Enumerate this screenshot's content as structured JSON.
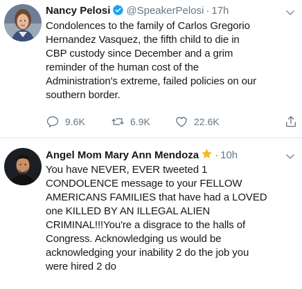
{
  "tweets": [
    {
      "name": "Nancy Pelosi",
      "handle": "@SpeakerPelosi",
      "separator": "·",
      "time": "17h",
      "text": "Condolences to the family of Carlos Gregorio\nHernandez Vasquez, the fifth child to die in\nCBP custody since December and a grim\nreminder of the human cost of the\nAdministration's extreme, failed policies on our\nsouthern border.",
      "replies": "9.6K",
      "retweets": "6.9K",
      "likes": "22.6K",
      "verified": true
    },
    {
      "name": "Angel Mom Mary Ann Mendoza",
      "separator": "·",
      "time": "10h",
      "text": "You have NEVER, EVER tweeted 1\nCONDOLENCE message to your FELLOW\nAMERICANS FAMILIES that have had a LOVED\none KILLED BY AN ILLEGAL ALIEN\nCRIMINAL!!!You're a disgrace to the halls of\nCongress.  Acknowledging us would be\nacknowledging your inability 2 do the job you\nwere hired 2 do"
    }
  ],
  "icons": {
    "verified": "verified-badge-icon",
    "star": "star-icon",
    "caret": "chevron-down-icon",
    "reply": "reply-icon",
    "retweet": "retweet-icon",
    "like": "heart-icon",
    "share": "share-icon"
  },
  "colors": {
    "text": "#14171a",
    "secondary": "#657786",
    "verified": "#1da1f2",
    "star": "#f5b81e",
    "divider": "#dfe3e6"
  }
}
